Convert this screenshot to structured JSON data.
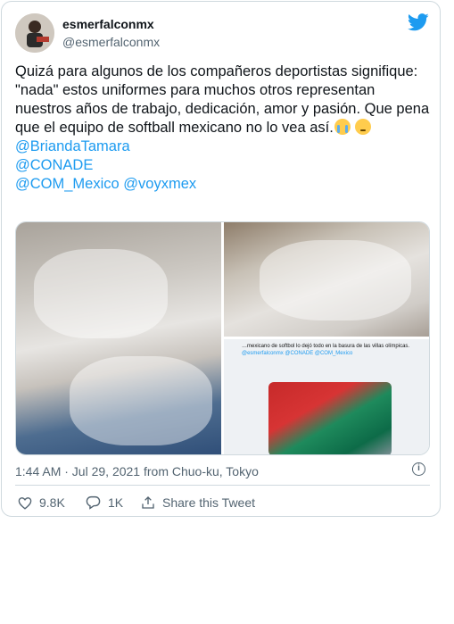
{
  "author": {
    "name": "esmerfalconmx",
    "handle": "@esmerfalconmx",
    "avatar": "avatar"
  },
  "brand_icon": "twitter-bird-icon",
  "tweet": {
    "body": "Quizá para algunos de los compañeros deportistas signifique: \"nada\" estos uniformes para muchos otros representan nuestros años de trabajo, dedicación, amor y pasión. Que pena que el equipo de softball mexicano no lo vea así.",
    "emojis": [
      "loudly-crying-face",
      "pensive-face"
    ],
    "mention_1": "@BriandaTamara",
    "mention_2": "@CONADE",
    "mention_3": "@COM_Mexico",
    "mention_4": "@voyxmex"
  },
  "media": {
    "screenshot_text": "…mexicano de softbol lo dejó todo en la basura de las villas olímpicas.",
    "screenshot_mentions": "@esmerfalconmx @CONADE @COM_Mexico"
  },
  "timestamp": "1:44 AM · Jul 29, 2021 from Chuo-ku, Tokyo",
  "actions": {
    "likes": "9.8K",
    "replies": "1K",
    "share": "Share this Tweet"
  },
  "colors": {
    "accent": "#1d9bf0",
    "text": "#0f1419",
    "muted": "#536471",
    "border": "#cfd9de"
  }
}
